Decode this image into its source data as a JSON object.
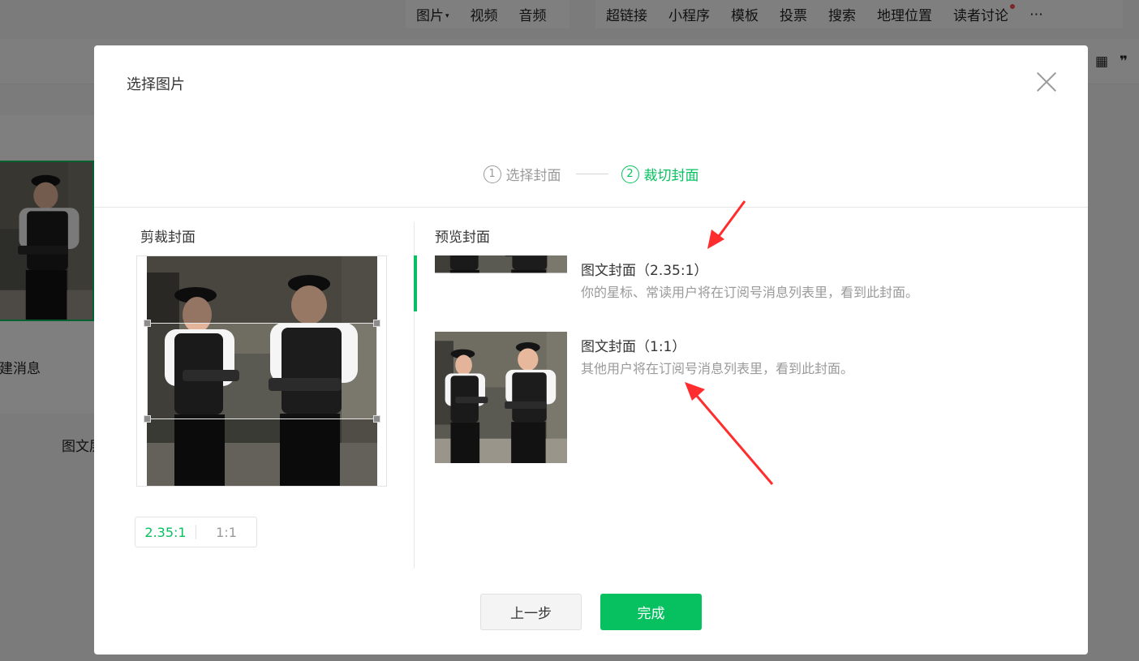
{
  "background": {
    "toolbar_group_1": [
      "图片",
      "视频",
      "音频"
    ],
    "toolbar_group_2": [
      "超链接",
      "小程序",
      "模板",
      "投票",
      "搜索",
      "地理位置",
      "读者讨论"
    ],
    "more_icon": "more-icon",
    "side_icons": [
      "table-icon",
      "quote-icon"
    ],
    "new_message": "新建消息",
    "tuwen_partial": "图文层"
  },
  "dialog": {
    "title": "选择图片",
    "steps": [
      {
        "num": "1",
        "label": "选择封面",
        "active": false
      },
      {
        "num": "2",
        "label": "裁切封面",
        "active": true
      }
    ],
    "crop": {
      "label": "剪裁封面",
      "ratios": [
        {
          "label": "2.35:1",
          "active": true
        },
        {
          "label": "1:1",
          "active": false
        }
      ]
    },
    "preview": {
      "label": "预览封面",
      "items": [
        {
          "title": "图文封面（2.35:1）",
          "desc": "你的星标、常读用户将在订阅号消息列表里，看到此封面。"
        },
        {
          "title": "图文封面（1:1）",
          "desc": "其他用户将在订阅号消息列表里，看到此封面。"
        }
      ]
    },
    "buttons": {
      "prev": "上一步",
      "done": "完成"
    }
  },
  "colors": {
    "accent": "#07c160",
    "annotation_arrow": "#ff2d2d"
  }
}
